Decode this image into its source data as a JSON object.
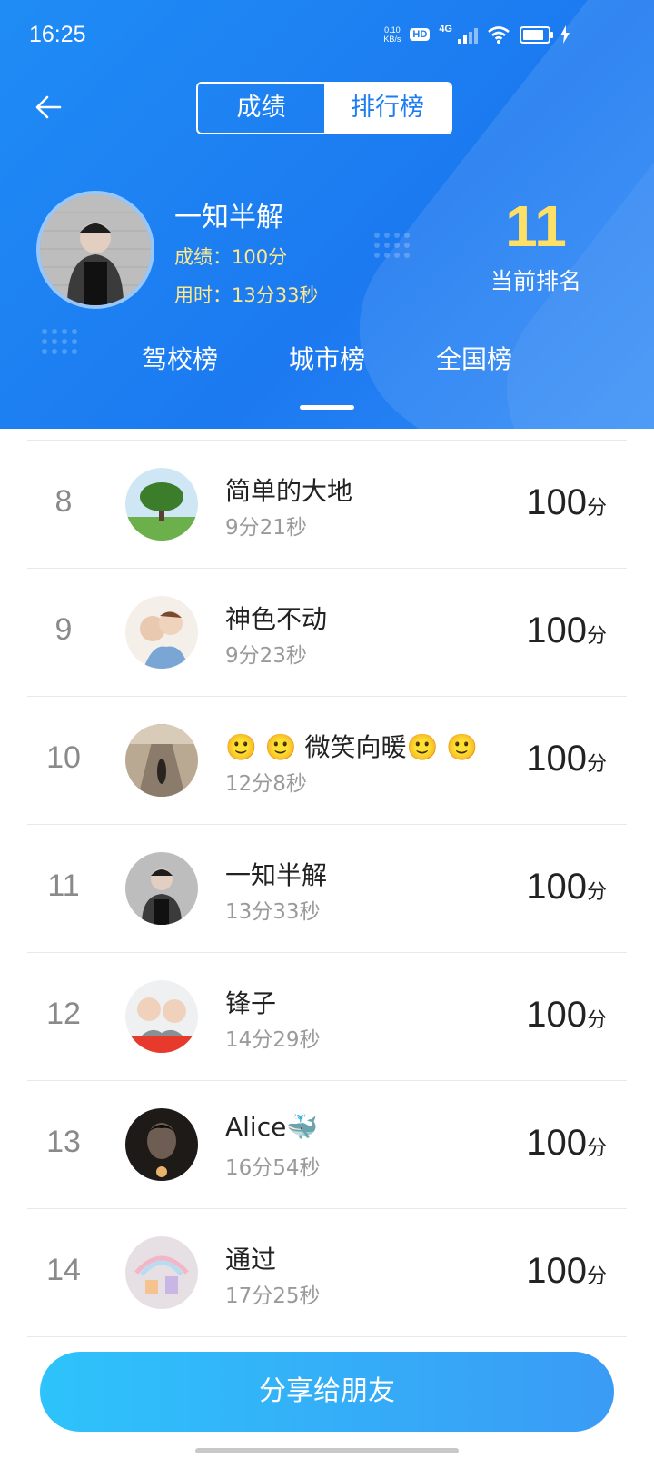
{
  "status_bar": {
    "time": "16:25",
    "net_speed_value": "0.10",
    "net_speed_unit": "KB/s",
    "hd": "HD",
    "network": "4G"
  },
  "header": {
    "segments": [
      "成绩",
      "排行榜"
    ],
    "active_segment": "排行榜",
    "user": {
      "name": "一知半解",
      "score_label": "成绩：100分",
      "time_label": "用时：13分33秒"
    },
    "rank_number": "11",
    "rank_label": "当前排名",
    "tabs": [
      "驾校榜",
      "城市榜",
      "全国榜"
    ],
    "active_tab": "城市榜"
  },
  "list": [
    {
      "rank": "8",
      "name": "简单的大地",
      "time": "9分21秒",
      "score": "100",
      "unit": "分"
    },
    {
      "rank": "9",
      "name": "神色不动",
      "time": "9分23秒",
      "score": "100",
      "unit": "分"
    },
    {
      "rank": "10",
      "name": "🙂 🙂 微笑向暖🙂 🙂",
      "time": "12分8秒",
      "score": "100",
      "unit": "分"
    },
    {
      "rank": "11",
      "name": "一知半解",
      "time": "13分33秒",
      "score": "100",
      "unit": "分"
    },
    {
      "rank": "12",
      "name": "锋子",
      "time": "14分29秒",
      "score": "100",
      "unit": "分"
    },
    {
      "rank": "13",
      "name": "Alice🐳",
      "time": "16分54秒",
      "score": "100",
      "unit": "分"
    },
    {
      "rank": "14",
      "name": "通过",
      "time": "17分25秒",
      "score": "100",
      "unit": "分"
    }
  ],
  "share_button": "分享给朋友",
  "colors": {
    "primary": "#1f7df2",
    "gold": "#ffe066",
    "share_start": "#2ec3fb",
    "share_end": "#3a9bf5"
  }
}
